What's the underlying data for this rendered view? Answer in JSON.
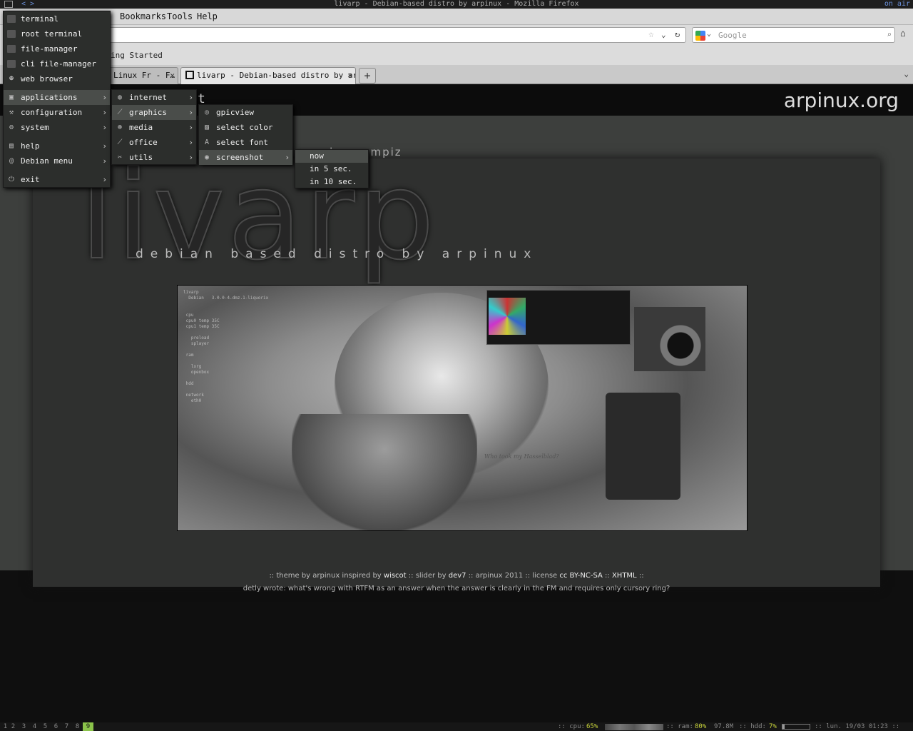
{
  "window": {
    "title": "livarp - Debian-based distro by arpinux - Mozilla Firefox",
    "status_right": "on air",
    "nav_arrows": "< >"
  },
  "menubar": {
    "items": [
      "Bookmarks",
      "Tools",
      "Help"
    ]
  },
  "navbar": {
    "search_placeholder": "Google"
  },
  "bookmarks_bar": {
    "item_fragment": "ing Started"
  },
  "tabs": [
    {
      "label": "Linux Fr - F…",
      "active": false
    },
    {
      "label": "livarp - Debian-based distro by ar…",
      "active": true
    }
  ],
  "page": {
    "site_name": "arpinux.org",
    "header_fragment": "t",
    "big_word": "livarp",
    "tagline": "debian based distro by arpinux",
    "wm_fragment": "wmaker-compiz",
    "screenshot_quote": "Who took my Hasselblad?",
    "footer_line1": [
      ":: theme by arpinux inspired by ",
      "wiscot",
      " :: slider by ",
      "dev7",
      " :: arpinux 2011 :: license ",
      "cc BY-NC-SA",
      " :: ",
      "XHTML",
      " ::"
    ],
    "footer_line2": "detly wrote: what's wrong with RTFM as an answer when the answer is clearly in the FM and requires only cursory ring?"
  },
  "root_menu": {
    "top_items": [
      {
        "label": "terminal",
        "icon": "terminal-icon"
      },
      {
        "label": "root terminal",
        "icon": "root-terminal-icon"
      },
      {
        "label": "file-manager",
        "icon": "folder-icon"
      },
      {
        "label": "cli file-manager",
        "icon": "folder-icon"
      },
      {
        "label": "web browser",
        "icon": "browser-icon"
      }
    ],
    "mid_items": [
      {
        "label": "applications",
        "icon": "applications-icon",
        "submenu": true,
        "selected": true
      },
      {
        "label": "configuration",
        "icon": "configuration-icon",
        "submenu": true
      },
      {
        "label": "system",
        "icon": "system-icon",
        "submenu": true
      }
    ],
    "help_items": [
      {
        "label": "help",
        "icon": "help-icon",
        "submenu": true
      },
      {
        "label": "Debian menu",
        "icon": "debian-icon",
        "submenu": true
      }
    ],
    "exit": {
      "label": "exit",
      "icon": "power-icon",
      "submenu": true
    }
  },
  "apps_menu": {
    "items": [
      {
        "label": "internet",
        "icon": "globe-icon"
      },
      {
        "label": "graphics",
        "icon": "brush-icon",
        "selected": true
      },
      {
        "label": "media",
        "icon": "media-icon"
      },
      {
        "label": "office",
        "icon": "office-icon"
      },
      {
        "label": "utils",
        "icon": "utils-icon"
      }
    ]
  },
  "graphics_menu": {
    "items": [
      {
        "label": "gpicview",
        "icon": "image-viewer-icon"
      },
      {
        "label": "select color",
        "icon": "color-picker-icon"
      },
      {
        "label": "select font",
        "icon": "font-icon"
      },
      {
        "label": "screenshot",
        "icon": "camera-icon",
        "selected": true
      }
    ]
  },
  "screenshot_menu": {
    "items": [
      {
        "label": "now",
        "selected": true
      },
      {
        "label": "in 5 sec."
      },
      {
        "label": "in 10 sec."
      }
    ]
  },
  "statusbar": {
    "workspaces": [
      "1",
      "2",
      "3",
      "4",
      "5",
      "6",
      "7",
      "8",
      "9"
    ],
    "current_workspace": "9",
    "cpu_label": ":: cpu:",
    "cpu_value": "65%",
    "ram_label": ":: ram:",
    "ram_value": "80%",
    "ram_used": "97.8M",
    "hdd_label": ":: hdd:",
    "hdd_value": "7%",
    "hdd_fill": 0.07,
    "datetime": ":: lun. 19/03 01:23 ::"
  }
}
